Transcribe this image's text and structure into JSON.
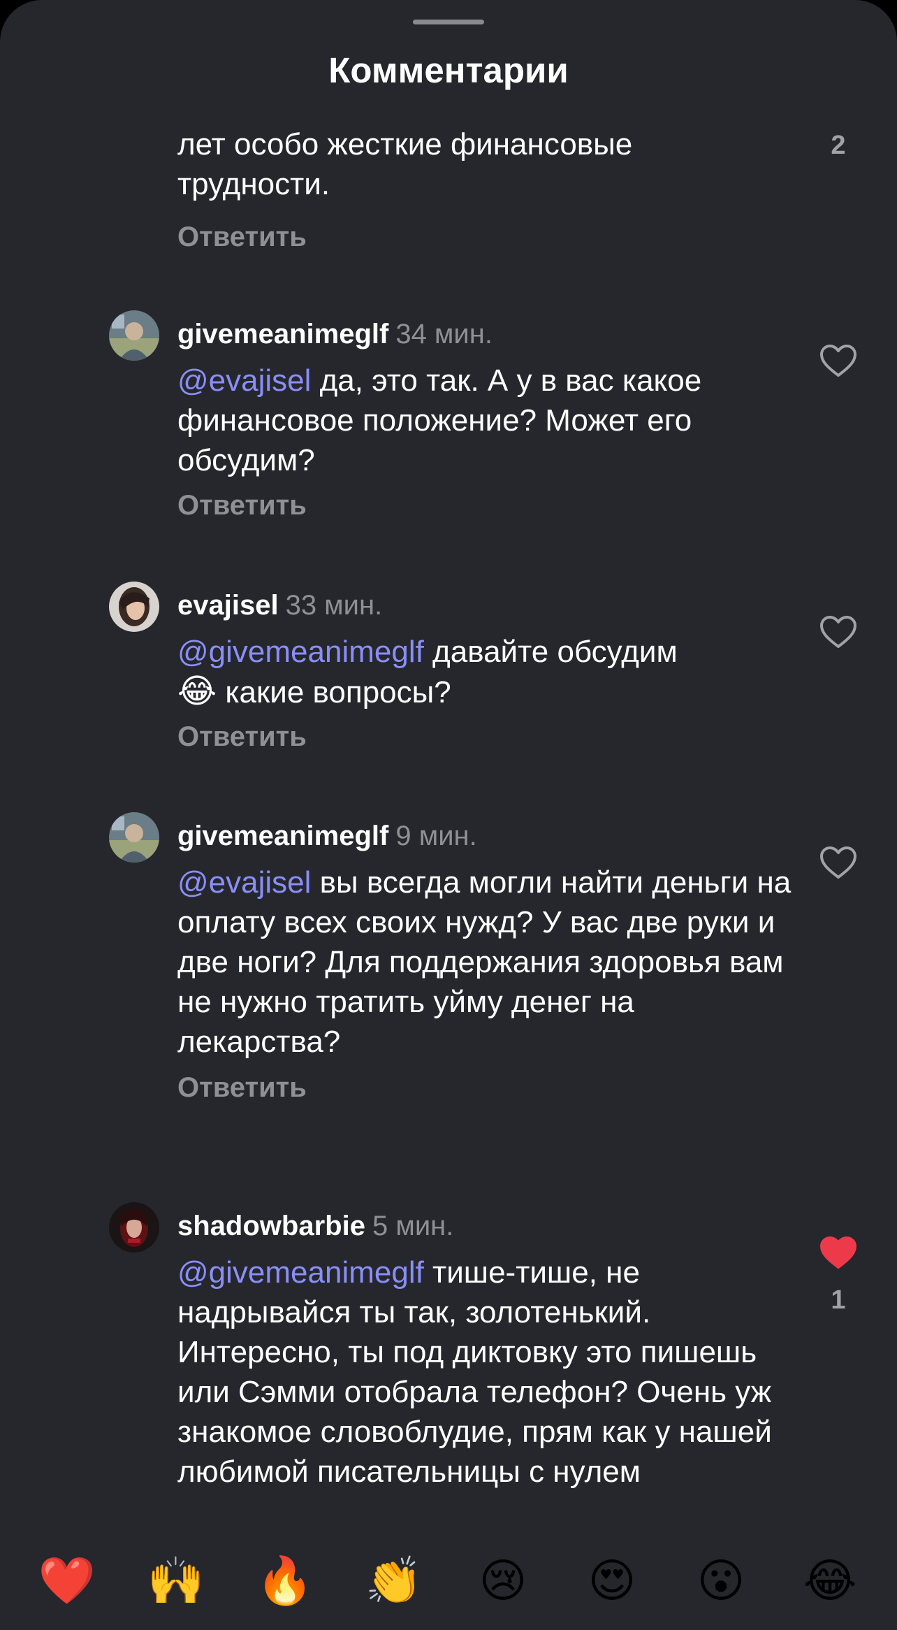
{
  "header": {
    "title": "Комментарии"
  },
  "comments": [
    {
      "body_lines": [
        "лет особо жесткие финансовые",
        "трудности."
      ],
      "reply_label": "Ответить",
      "like_count": "2"
    },
    {
      "username": "givemeanimeglf",
      "time": "34 мин.",
      "mention": "@evajisel",
      "text": " да, это так. А у в вас какое финансовое положение? Может его обсудим?",
      "reply_label": "Ответить",
      "liked": false
    },
    {
      "username": "evajisel",
      "time": "33 мин.",
      "mention": "@givemeanimeglf",
      "text_before_emoji": " давайте обсудим",
      "emoji": "😂",
      "text_after_emoji": " какие вопросы?",
      "reply_label": "Ответить",
      "liked": false
    },
    {
      "username": "givemeanimeglf",
      "time": "9 мин.",
      "mention": "@evajisel",
      "text": " вы всегда могли найти деньги на оплату всех своих нужд? У вас две руки и две ноги? Для поддержания здоровья вам не нужно тратить уйму денег на лекарства?",
      "reply_label": "Ответить",
      "liked": false
    },
    {
      "username": "shadowbarbie",
      "time": "5 мин.",
      "mention": "@givemeanimeglf",
      "text": " тише-тише, не надрывайся ты так, золотенький. Интересно, ты под диктовку это пишешь или Сэмми отобрала телефон? Очень уж знакомое словоблудие, прям как у нашей любимой писательницы с нулем",
      "liked": true,
      "like_count": "1"
    }
  ],
  "emoji_bar": [
    "❤️",
    "🙌",
    "🔥",
    "👏",
    "😢",
    "😍",
    "😮",
    "😂"
  ],
  "colors": {
    "background": "#25272c",
    "mention": "#8a8ef7",
    "muted": "#8e9096",
    "liked_heart": "#ed3a4a"
  },
  "icons": {
    "heart_outline": "heart-outline-icon",
    "heart_filled": "heart-filled-icon"
  }
}
